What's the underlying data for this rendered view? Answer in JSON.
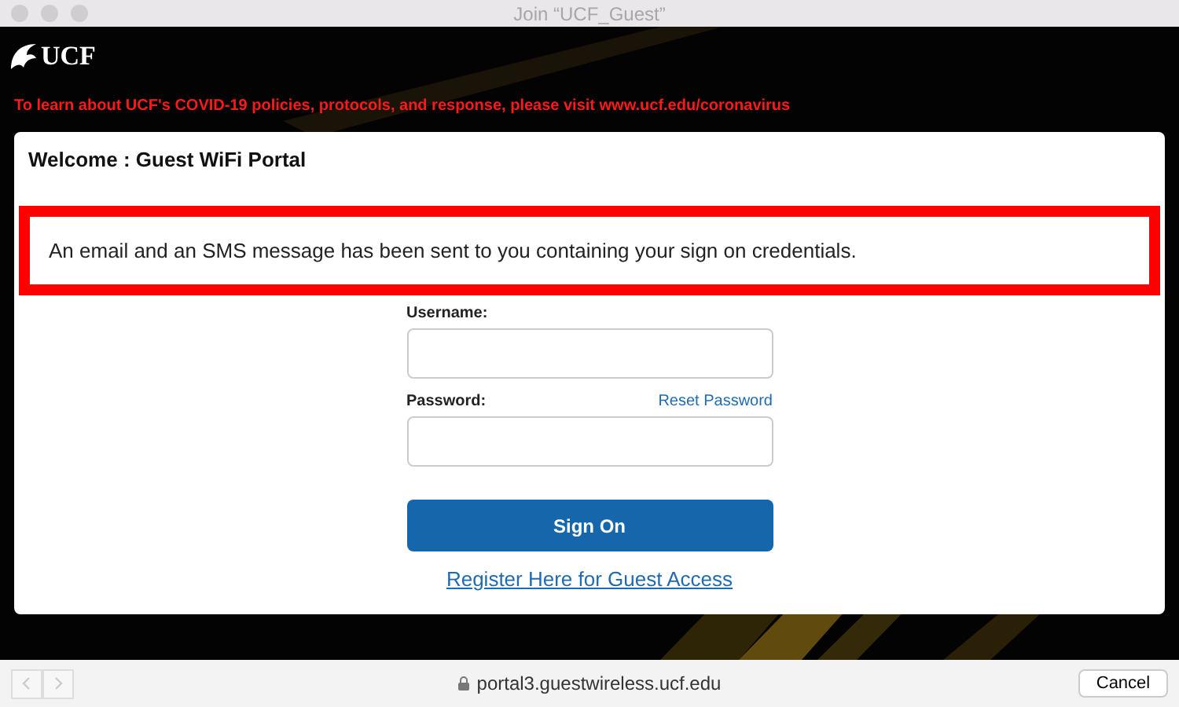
{
  "window": {
    "title": "Join “UCF_Guest”"
  },
  "header": {
    "logo_text": "UCF",
    "notice": "To learn about UCF's COVID-19 policies, protocols, and response, please visit www.ucf.edu/coronavirus"
  },
  "portal": {
    "title": "Welcome : Guest WiFi Portal",
    "alert": "An email and an SMS message has been sent to you containing your sign on credentials.",
    "username_label": "Username:",
    "password_label": "Password:",
    "reset_link": "Reset Password",
    "submit": "Sign On",
    "register_link": "Register Here for Guest Access"
  },
  "toolbar": {
    "back_disabled": true,
    "forward_disabled": true,
    "address": "portal3.guestwireless.ucf.edu",
    "cancel": "Cancel"
  }
}
